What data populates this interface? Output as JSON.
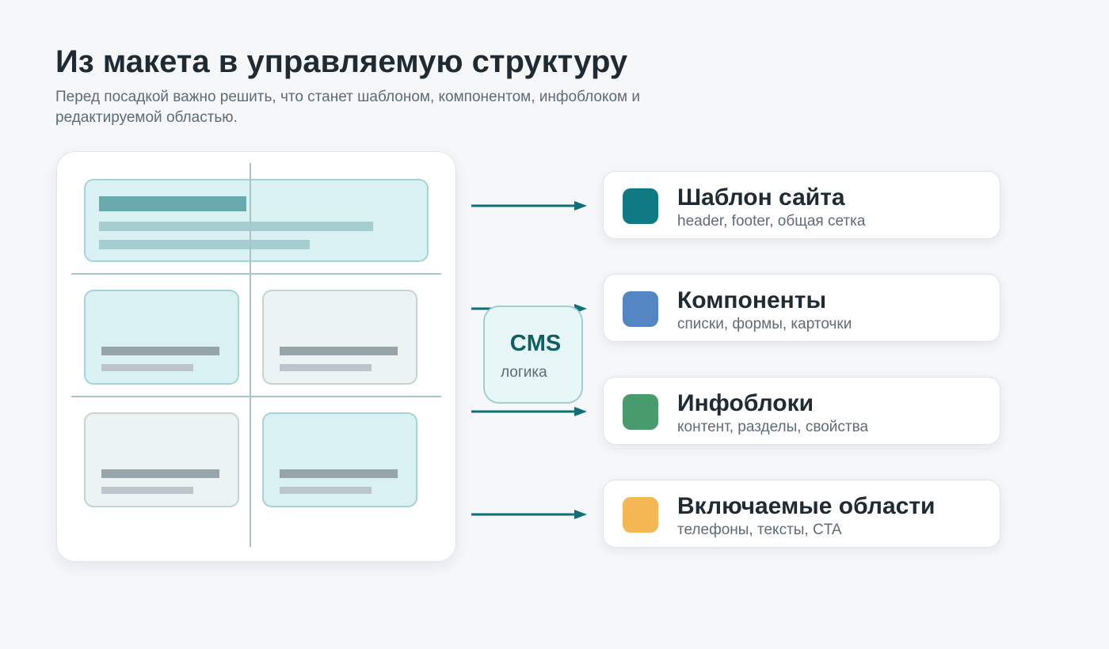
{
  "header": {
    "title": "Из макета в управляемую структуру",
    "subtitle": "Перед посадкой важно решить, что станет шаблоном, компонентом, инфоблоком и редактируемой областью."
  },
  "cms": {
    "title": "CMS",
    "subtitle": "логика"
  },
  "cards": [
    {
      "title": "Шаблон сайта",
      "subtitle": "header, footer, общая сетка",
      "color": "#0f7a83"
    },
    {
      "title": "Компоненты",
      "subtitle": "списки, формы, карточки",
      "color": "#5486c3"
    },
    {
      "title": "Инфоблоки",
      "subtitle": "контент, разделы, свойства",
      "color": "#479b6c"
    },
    {
      "title": "Включаемые области",
      "subtitle": "телефоны, тексты, CTA",
      "color": "#f5b654"
    }
  ],
  "colors": {
    "arrow": "#0f6f78",
    "accent_teal": "#0f7a83"
  }
}
